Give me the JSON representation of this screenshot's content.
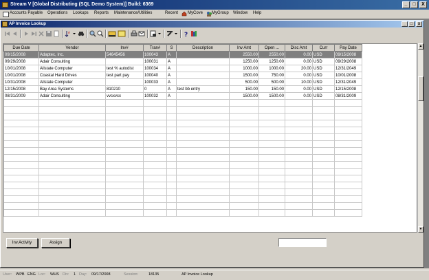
{
  "window": {
    "title": "Stream V [Global Distributing (SQL Demo System)] Build: 6369",
    "min": "_",
    "max": "□",
    "close": "X"
  },
  "menu": {
    "items": [
      "Accounts Payable",
      "Operations",
      "Lookups",
      "Reports",
      "Maintenance/Utilities"
    ],
    "right_items": [
      "Recent",
      "MyCove",
      "MyGroup",
      "Window",
      "Help"
    ]
  },
  "child_window": {
    "title": "AP Invoice Lookup",
    "min": "_",
    "max": "□",
    "close": "x"
  },
  "grid": {
    "columns": [
      "Due Date",
      "Vendor",
      "Inv#",
      "Tran#",
      "S",
      "Description",
      "Inv Amt",
      "Open ...",
      "Disc Amt",
      "Curr",
      "Pay Date"
    ],
    "rows": [
      [
        "09/15/2008",
        "Adaptec, Inc.",
        "54645456",
        "100043",
        "A",
        "",
        "2550.00",
        "2550.00",
        "0.00",
        "USD",
        "09/15/2008"
      ],
      [
        "09/29/2008",
        "Adair Consulting",
        "",
        "100031",
        "A",
        "",
        "1250.00",
        "1250.00",
        "0.00",
        "USD",
        "09/29/2008"
      ],
      [
        "10/01/2008",
        "Allstate Computer",
        "test % autodist",
        "100034",
        "A",
        "",
        "1000.00",
        "1000.00",
        "20.00",
        "USD",
        "12/31/2049"
      ],
      [
        "10/01/2008",
        "Coastal Hard Drives",
        "test part pay",
        "100040",
        "A",
        "",
        "1500.00",
        "750.00",
        "0.00",
        "USD",
        "10/01/2008"
      ],
      [
        "10/31/2008",
        "Allstate Computer",
        "",
        "100033",
        "A",
        "",
        "500.00",
        "500.00",
        "10.00",
        "USD",
        "12/31/2049"
      ],
      [
        "12/15/2008",
        "Bay Area Systems",
        "810210",
        "0",
        "A",
        "test bb entry",
        "150.00",
        "150.00",
        "0.00",
        "USD",
        "12/15/2008"
      ],
      [
        "08/31/2009",
        "Adair Consulting",
        "vvcxvcx",
        "100032",
        "A",
        "",
        "1500.00",
        "1500.00",
        "0.00",
        "USD",
        "08/31/2009"
      ]
    ],
    "selected_row": 0
  },
  "buttons": {
    "inv_activity": "Inv.Activity",
    "assign": "Assign"
  },
  "status": {
    "user_label": "User:",
    "user": "WPB",
    "lang_label": "",
    "lang": "ENG",
    "loc_label": "Loc:",
    "loc": "WHS",
    "div_label": "Div:",
    "div": "1",
    "day_label": "Day:",
    "day": "09/17/2008",
    "session_label": "Session:",
    "session": "18135",
    "screen": "AP Invoice Lookup"
  },
  "colors": {
    "title_bar": "#0a246a",
    "selected_row": "#808080",
    "window_bg": "#d4d0c8"
  }
}
